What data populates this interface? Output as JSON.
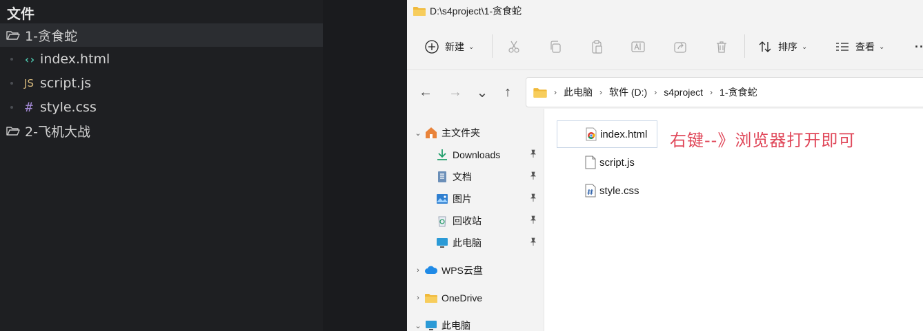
{
  "editor": {
    "title": "文件",
    "tree": [
      {
        "label": "1-贪食蛇",
        "kind": "folder",
        "selected": true
      },
      {
        "label": "index.html",
        "kind": "html",
        "icon": "‹›"
      },
      {
        "label": "script.js",
        "kind": "js",
        "icon": "JS"
      },
      {
        "label": "style.css",
        "kind": "css",
        "icon": "#"
      },
      {
        "label": "2-飞机大战",
        "kind": "folder"
      }
    ]
  },
  "explorer": {
    "window_title": "D:\\s4project\\1-贪食蛇",
    "toolbar": {
      "new_label": "新建",
      "sort_label": "排序",
      "view_label": "查看",
      "more_label": "···"
    },
    "nav": {
      "back_icon": "←",
      "forward_icon": "→",
      "recent_icon": "⌄",
      "up_icon": "↑"
    },
    "breadcrumb": [
      "此电脑",
      "软件 (D:)",
      "s4project",
      "1-贪食蛇"
    ],
    "breadcrumb_sep": "›",
    "nav_pane": {
      "home": "主文件夹",
      "quick_access": [
        {
          "label": "Downloads",
          "icon": "download-icon"
        },
        {
          "label": "文档",
          "icon": "document-icon"
        },
        {
          "label": "图片",
          "icon": "pictures-icon"
        },
        {
          "label": "回收站",
          "icon": "recycle-bin-icon"
        },
        {
          "label": "此电脑",
          "icon": "computer-icon"
        }
      ],
      "pin_icon": "📌",
      "wps": "WPS云盘",
      "onedrive": "OneDrive",
      "this_pc": "此电脑",
      "chev_collapsed": "›",
      "chev_expanded": "⌄"
    },
    "files": [
      {
        "name": "index.html",
        "icon": "chrome-html-icon",
        "selected": true
      },
      {
        "name": "script.js",
        "icon": "blank-file-icon"
      },
      {
        "name": "style.css",
        "icon": "css-file-icon"
      }
    ],
    "annotation": "右键--》浏览器打开即可",
    "colors": {
      "annotation": "#e0485a",
      "folder": "#f0b93a",
      "accent": "#0a64c8"
    }
  }
}
